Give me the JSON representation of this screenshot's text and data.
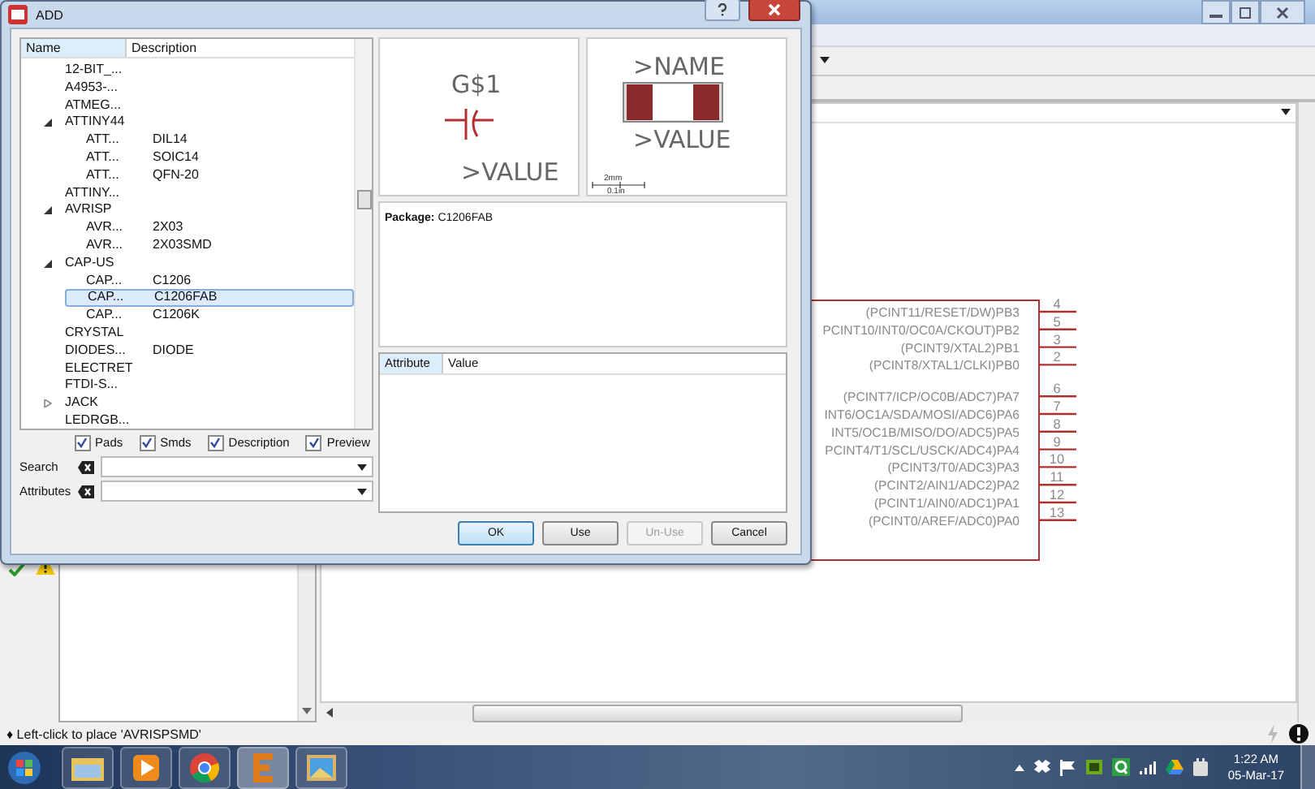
{
  "dialog": {
    "title": "ADD",
    "tree": {
      "columns": [
        "Name",
        "Description"
      ],
      "items": [
        {
          "name": "12-BIT_...",
          "selected": false
        },
        {
          "name": "A4953-...",
          "selected": false
        },
        {
          "name": "ATMEG...",
          "selected": false
        },
        {
          "name": "ATTINY44",
          "selected": false,
          "expanded": true,
          "children": [
            {
              "name": "ATT...",
              "description": "DIL14",
              "selected": false
            },
            {
              "name": "ATT...",
              "description": "SOIC14",
              "selected": false
            },
            {
              "name": "ATT...",
              "description": "QFN-20",
              "selected": false
            }
          ]
        },
        {
          "name": "ATTINY...",
          "selected": false
        },
        {
          "name": "AVRISP",
          "selected": false,
          "expanded": true,
          "children": [
            {
              "name": "AVR...",
              "description": "2X03",
              "selected": false
            },
            {
              "name": "AVR...",
              "description": "2X03SMD",
              "selected": false
            }
          ]
        },
        {
          "name": "CAP-US",
          "selected": false,
          "expanded": true,
          "children": [
            {
              "name": "CAP...",
              "description": "C1206",
              "selected": false
            },
            {
              "name": "CAP...",
              "description": "C1206FAB",
              "selected": true
            },
            {
              "name": "CAP...",
              "description": "C1206K",
              "selected": false
            }
          ]
        },
        {
          "name": "CRYSTAL",
          "selected": false
        },
        {
          "name": "DIODES...",
          "description": "DIODE",
          "selected": false
        },
        {
          "name": "ELECTRET",
          "selected": false
        },
        {
          "name": "FTDI-S...",
          "selected": false
        },
        {
          "name": "JACK",
          "selected": false,
          "expanded": false
        },
        {
          "name": "LEDRGB...",
          "selected": false
        }
      ]
    },
    "filters": [
      {
        "label": "Pads",
        "checked": true
      },
      {
        "label": "Smds",
        "checked": true
      },
      {
        "label": "Description",
        "checked": true
      },
      {
        "label": "Preview",
        "checked": true
      }
    ],
    "search": {
      "label": "Search"
    },
    "attributes_filter": {
      "label": "Attributes"
    },
    "symbol_preview": {
      "name": "G$1",
      "value": ">VALUE"
    },
    "package_preview": {
      "name": ">NAME",
      "value": ">VALUE",
      "scale_top": "2mm",
      "scale_bottom": "0.1in"
    },
    "package_info": {
      "label": "Package:",
      "value": "C1206FAB"
    },
    "attribute_table": {
      "columns": [
        "Attribute",
        "Value"
      ]
    },
    "buttons": [
      {
        "label": "OK",
        "default": true,
        "disabled": false
      },
      {
        "label": "Use",
        "default": false,
        "disabled": false
      },
      {
        "label": "Un-Use",
        "default": false,
        "disabled": true
      },
      {
        "label": "Cancel",
        "default": false,
        "disabled": false
      }
    ]
  },
  "schematic": {
    "pin_groups": [
      [
        {
          "label": "(PCINT11/RESET/DW)PB3",
          "number": "4"
        },
        {
          "label": "PCINT10/INT0/OC0A/CKOUT)PB2",
          "number": "5"
        },
        {
          "label": "(PCINT9/XTAL2)PB1",
          "number": "3"
        },
        {
          "label": "(PCINT8/XTAL1/CLKI)PB0",
          "number": "2"
        }
      ],
      [
        {
          "label": "(PCINT7/ICP/OC0B/ADC7)PA7",
          "number": "6"
        },
        {
          "label": "INT6/OC1A/SDA/MOSI/ADC6)PA6",
          "number": "7"
        },
        {
          "label": "INT5/OC1B/MISO/DO/ADC5)PA5",
          "number": "8"
        },
        {
          "label": "PCINT4/T1/SCL/USCK/ADC4)PA4",
          "number": "9"
        },
        {
          "label": "(PCINT3/T0/ADC3)PA3",
          "number": "10"
        },
        {
          "label": "(PCINT2/AIN1/ADC2)PA2",
          "number": "11"
        },
        {
          "label": "(PCINT1/AIN0/ADC1)PA1",
          "number": "12"
        },
        {
          "label": "(PCINT0/AREF/ADC0)PA0",
          "number": "13"
        }
      ]
    ]
  },
  "status_bar": {
    "message": "♦ Left-click to place 'AVRISPSMD'"
  },
  "taskbar": {
    "time": "1:22 AM",
    "date": "05-Mar-17"
  }
}
